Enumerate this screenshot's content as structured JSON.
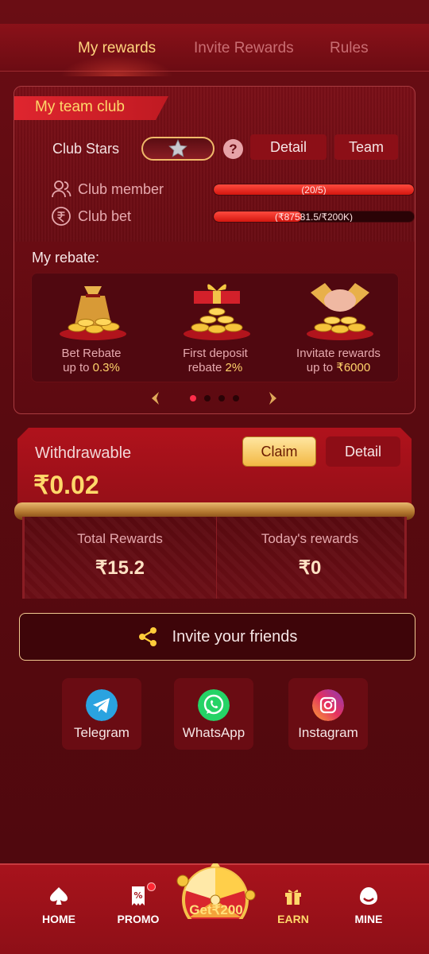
{
  "tabs": [
    {
      "label": "My rewards",
      "active": true
    },
    {
      "label": "Invite Rewards",
      "active": false
    },
    {
      "label": "Rules",
      "active": false
    }
  ],
  "club": {
    "title": "My team club",
    "stars_label": "Club Stars",
    "detail_button": "Detail",
    "team_button": "Team",
    "member_label": "Club member",
    "member_progress": "(20/5)",
    "member_fraction": 1.0,
    "bet_label": "Club bet",
    "bet_progress": "(₹87581.5/₹200K)",
    "bet_fraction": 0.44
  },
  "rebate": {
    "title": "My rebate:",
    "items": [
      {
        "line1": "Bet Rebate",
        "line2_prefix": "up to ",
        "line2_value": "0.3%"
      },
      {
        "line1": "First deposit",
        "line2_prefix": "rebate ",
        "line2_value": "2%"
      },
      {
        "line1": "Invitate rewards",
        "line2_prefix": "up to ",
        "line2_value": "₹6000"
      }
    ],
    "page_count": 4,
    "current_page": 1
  },
  "withdraw": {
    "label": "Withdrawable",
    "amount": "₹0.02",
    "claim_button": "Claim",
    "detail_button": "Detail"
  },
  "rewards": {
    "total_label": "Total Rewards",
    "total_value": "₹15.2",
    "today_label": "Today's rewards",
    "today_value": "₹0"
  },
  "invite": {
    "label": "Invite your friends"
  },
  "social": [
    {
      "label": "Telegram",
      "icon": "telegram-icon"
    },
    {
      "label": "WhatsApp",
      "icon": "whatsapp-icon"
    },
    {
      "label": "Instagram",
      "icon": "instagram-icon"
    }
  ],
  "nav": {
    "home": "HOME",
    "promo": "PROMO",
    "wheel": "Get₹200",
    "earn": "EARN",
    "mine": "MINE"
  },
  "colors": {
    "background": "#5a0a10",
    "accent_gold": "#ffd86a",
    "accent_red": "#e0262f"
  }
}
